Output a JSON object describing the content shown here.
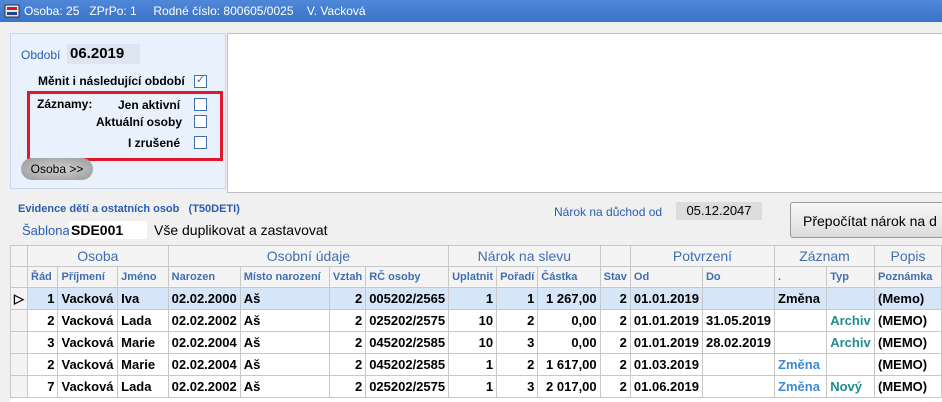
{
  "title": "Osoba: 25   ZPrPo: 1     Rodné číslo: 800605/0025    V. Vacková",
  "panel": {
    "obdobi_label": "Období",
    "obdobi_value": "06.2019",
    "menit_label": "Měnit i následující období",
    "zaznamy_label": "Záznamy:",
    "jen_aktivni": "Jen aktivní",
    "aktualni_osoby": "Aktuální osoby",
    "i_zrusene": "I zrušené",
    "osoba_button": "Osoba >>"
  },
  "evidence_title": "Evidence dětí a ostatních osob   (T50DETI)",
  "narok_label": "Nárok na důchod od",
  "narok_value": "05.12.2047",
  "sablona_label": "Šablona",
  "sablona_code": "SDE001",
  "sablona_desc": "Vše duplikovat a zastavovat",
  "recalc_button": "Přepočítat nárok na d",
  "groups": [
    "Osoba",
    "Osobní údaje",
    "Nárok na slevu",
    "Potvrzení",
    "Záznam",
    "Popis"
  ],
  "columns": [
    "Řád",
    "Příjmení",
    "Jméno",
    "Narozen",
    "Místo narození",
    "Vztah",
    "RČ osoby",
    "Uplatnit",
    "Pořadí",
    "Částka",
    "Stav",
    "Od",
    "Do",
    ".",
    "Typ",
    "Poznámka"
  ],
  "rows": [
    {
      "rad": "1",
      "prijmeni": "Vacková",
      "jmeno": "Iva",
      "narozen": "02.02.2000",
      "misto": "Aš",
      "vztah": "2",
      "rc": "005202/2565",
      "uplatnit": "1",
      "poradi": "1",
      "castka": "1 267,00",
      "stav": "2",
      "od": "01.01.2019",
      "do": "",
      "zaznam": "Změna",
      "typ": "",
      "poznamka": "(Memo)"
    },
    {
      "rad": "2",
      "prijmeni": "Vacková",
      "jmeno": "Lada",
      "narozen": "02.02.2002",
      "misto": "Aš",
      "vztah": "2",
      "rc": "025202/2575",
      "uplatnit": "10",
      "poradi": "2",
      "castka": "0,00",
      "stav": "2",
      "od": "01.01.2019",
      "do": "31.05.2019",
      "zaznam": "",
      "typ": "Archiv",
      "poznamka": "(MEMO)"
    },
    {
      "rad": "3",
      "prijmeni": "Vacková",
      "jmeno": "Marie",
      "narozen": "02.02.2004",
      "misto": "Aš",
      "vztah": "2",
      "rc": "045202/2585",
      "uplatnit": "10",
      "poradi": "3",
      "castka": "0,00",
      "stav": "2",
      "od": "01.01.2019",
      "do": "28.02.2019",
      "zaznam": "",
      "typ": "Archiv",
      "poznamka": "(MEMO)"
    },
    {
      "rad": "2",
      "prijmeni": "Vacková",
      "jmeno": "Marie",
      "narozen": "02.02.2004",
      "misto": "Aš",
      "vztah": "2",
      "rc": "045202/2585",
      "uplatnit": "1",
      "poradi": "2",
      "castka": "1 617,00",
      "stav": "2",
      "od": "01.03.2019",
      "do": "",
      "zaznam": "Změna",
      "typ": "",
      "poznamka": "(MEMO)"
    },
    {
      "rad": "7",
      "prijmeni": "Vacková",
      "jmeno": "Lada",
      "narozen": "02.02.2002",
      "misto": "Aš",
      "vztah": "2",
      "rc": "025202/2575",
      "uplatnit": "1",
      "poradi": "3",
      "castka": "2 017,00",
      "stav": "2",
      "od": "01.06.2019",
      "do": "",
      "zaznam": "Změna",
      "typ": "Nový",
      "poznamka": "(MEMO)"
    }
  ]
}
